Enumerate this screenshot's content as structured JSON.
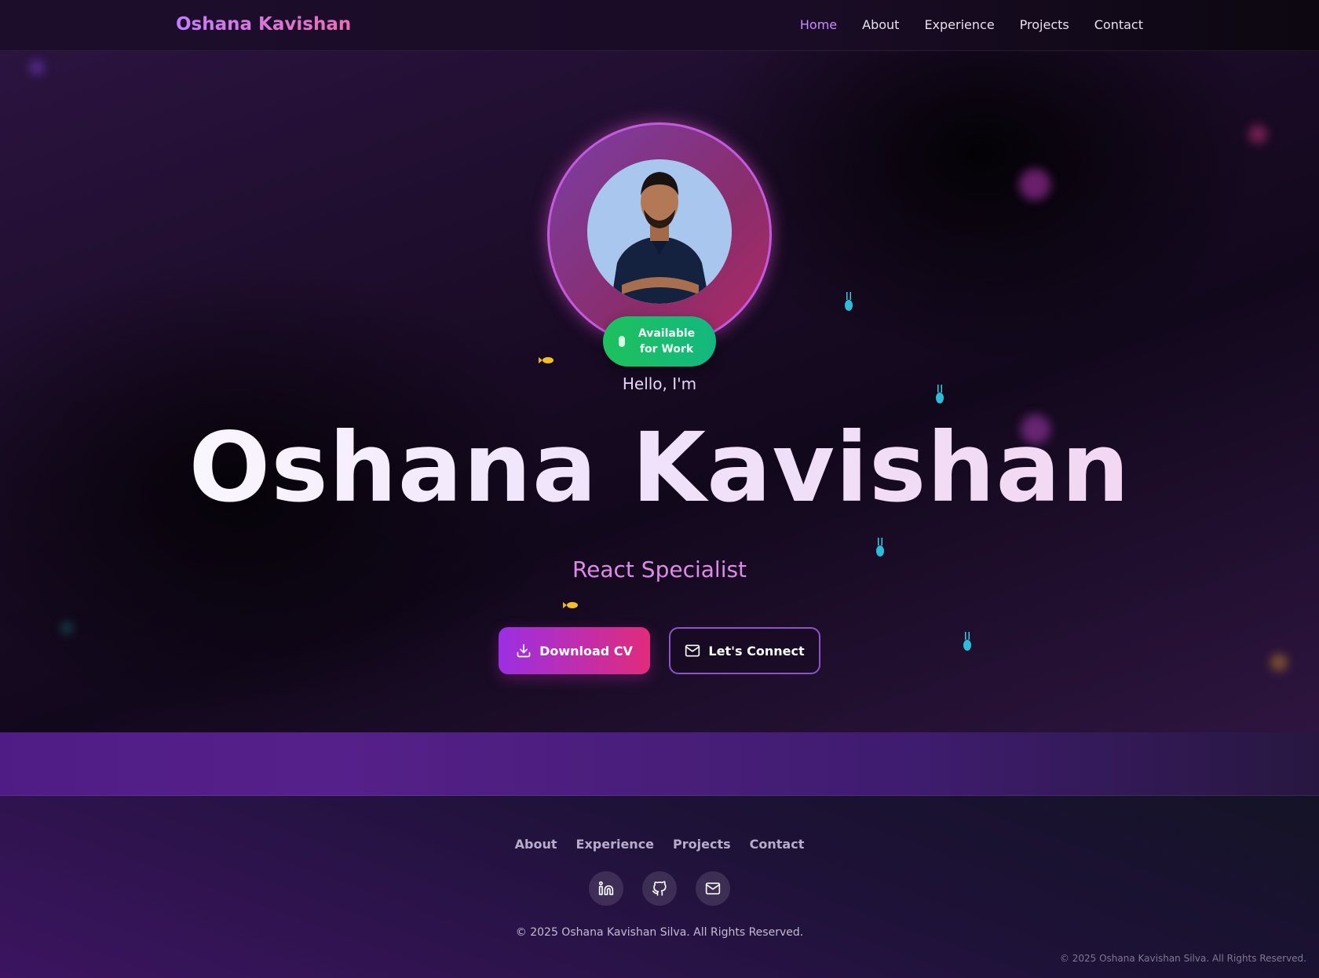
{
  "nav": {
    "brand": "Oshana Kavishan",
    "links": [
      {
        "label": "Home",
        "active": true
      },
      {
        "label": "About",
        "active": false
      },
      {
        "label": "Experience",
        "active": false
      },
      {
        "label": "Projects",
        "active": false
      },
      {
        "label": "Contact",
        "active": false
      }
    ]
  },
  "hero": {
    "status": "Available for Work",
    "greeting": "Hello, I'm",
    "name": "Oshana Kavishan",
    "role": "React Specialist",
    "download_button": "Download CV",
    "connect_button": "Let's Connect"
  },
  "footer": {
    "links": [
      "About",
      "Experience",
      "Projects",
      "Contact"
    ],
    "socials": [
      "linkedin-icon",
      "github-icon",
      "mail-icon"
    ],
    "copyright": "© 2025 Oshana Kavishan Silva. All Rights Reserved.",
    "copyright_corner": "© 2025 Oshana Kavishan Silva. All Rights Reserved."
  },
  "colors": {
    "accent_purple": "#9b2fe3",
    "accent_pink": "#e02c7c",
    "status_green": "#1ec15d",
    "nav_active": "#c98bff"
  }
}
